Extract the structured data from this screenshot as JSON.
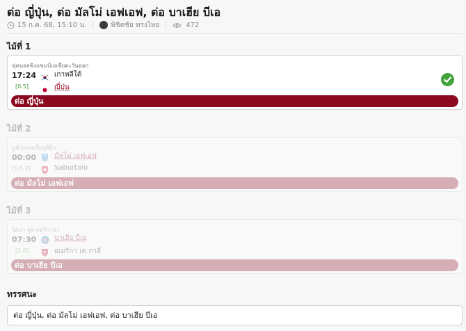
{
  "page": {
    "title": "ต่อ ญี่ปุ่น, ต่อ มัลโม่ เอฟเอฟ, ต่อ บาเฮีย บีเอ",
    "meta": {
      "date": "15 ก.ค. 68, 15:10 น.",
      "author": "พิชิตชัย ทรงไทย",
      "views": "472"
    }
  },
  "picks": [
    {
      "heading": "ไม้ที่ 1",
      "league": "ฟุตบอลชิงแชมป์เอเชียตะวันออก",
      "time": "17:24",
      "handicap": "[0.5]",
      "home": {
        "name": "เกาหลีใต้",
        "flag": "korea-flag-icon"
      },
      "away": {
        "name": "ญี่ปุ่น",
        "flag": "japan-flag-icon"
      },
      "favorite": "away",
      "bet": "ต่อ ญี่ปุ่น",
      "status": "won"
    },
    {
      "heading": "ไม้ที่ 2",
      "league": "ยูฟ่าแชมเปี้ยนส์ลีก",
      "time": "00:00",
      "handicap": "[1.5-2]",
      "home": {
        "name": "มัลโม่ เอฟเอฟ",
        "flag": "malmo-crest-icon"
      },
      "away": {
        "name": "Saburtalo",
        "flag": "saburtalo-crest-icon"
      },
      "favorite": "home",
      "bet": "ต่อ มัลโม่ เอฟเอฟ",
      "status": "pending"
    },
    {
      "heading": "ไม้ที่ 3",
      "league": "โคปา ซูดาเมริกาน่า",
      "time": "07:30",
      "handicap": "[1.0]",
      "home": {
        "name": "บาเฮีย บีเอ",
        "flag": "bahia-crest-icon"
      },
      "away": {
        "name": "อเมริกา เด กาลี",
        "flag": "america-de-cali-crest-icon"
      },
      "favorite": "home",
      "bet": "ต่อ บาเฮีย บีเอ",
      "status": "pending"
    }
  ],
  "comment": {
    "heading": "ทรรศนะ",
    "text": "ต่อ ญี่ปุ่น, ต่อ มัลโม่ เอฟเอฟ, ต่อ บาเฮีย บีเอ"
  },
  "colors": {
    "accent": "#8b0a21",
    "success": "#41a33c",
    "handicap": "#3a9a3a"
  }
}
